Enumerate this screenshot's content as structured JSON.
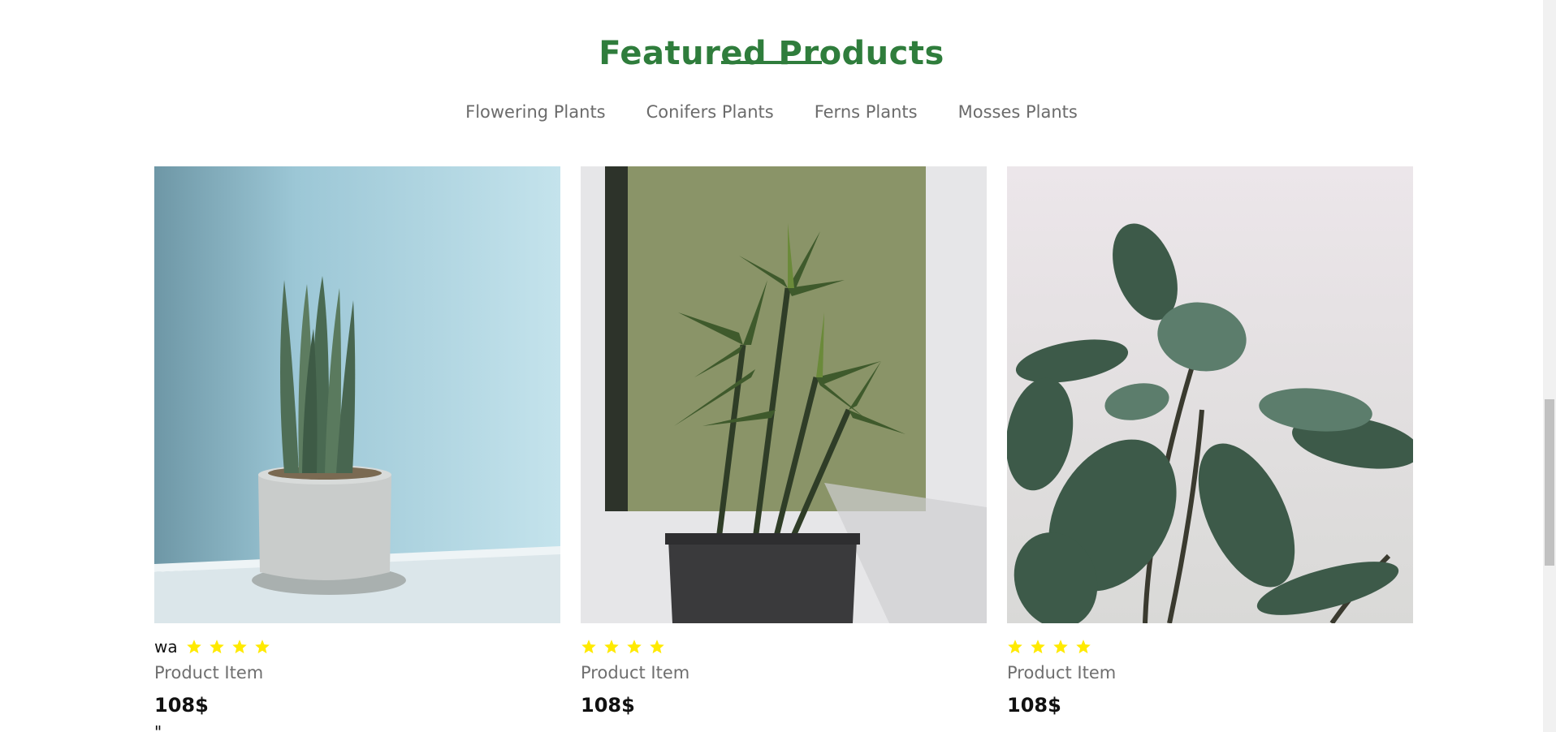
{
  "section": {
    "title": "Featured Products"
  },
  "categories": [
    {
      "label": "Flowering Plants"
    },
    {
      "label": "Conifers Plants"
    },
    {
      "label": "Ferns Plants"
    },
    {
      "label": "Mosses Plants"
    }
  ],
  "products": [
    {
      "rating_prefix": "wa",
      "rating": 4,
      "name": "Product Item",
      "price": "108$",
      "stray_mark": "\""
    },
    {
      "rating_prefix": "",
      "rating": 4,
      "name": "Product Item",
      "price": "108$"
    },
    {
      "rating_prefix": "",
      "rating": 4,
      "name": "Product Item",
      "price": "108$"
    }
  ],
  "colors": {
    "accent_green": "#2f7d3c",
    "star_yellow": "#ffea00",
    "muted_text": "#6f6f6f"
  },
  "icons": {
    "rating_star": "star-icon"
  }
}
